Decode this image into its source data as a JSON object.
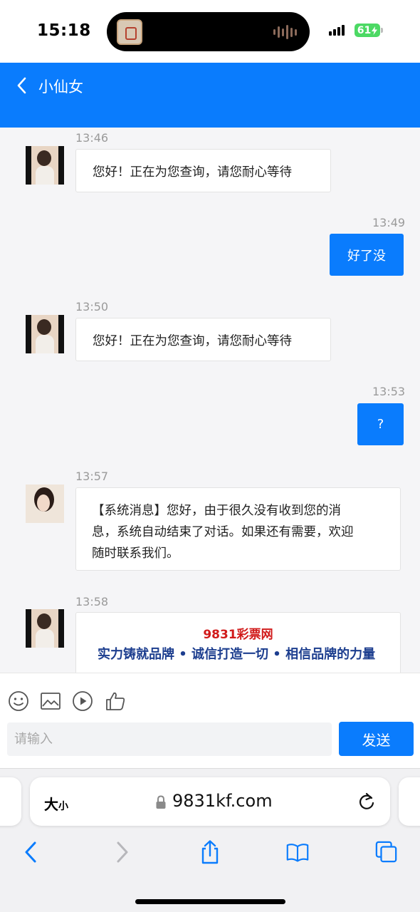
{
  "status_bar": {
    "time": "15:18",
    "battery": "61",
    "icons": [
      "app-thumbnail-icon",
      "audio-wave-icon",
      "cellular-signal-icon",
      "charging-bolt-icon"
    ]
  },
  "header": {
    "title": "小仙女",
    "back_icon": "chevron-left-icon",
    "background": "#0a7cfd"
  },
  "messages": [
    {
      "time": "13:46",
      "from": "agent",
      "text": "您好！正在为您查询，请您耐心等待"
    },
    {
      "time": "13:49",
      "from": "user",
      "text": "好了没"
    },
    {
      "time": "13:50",
      "from": "agent",
      "text": "您好！正在为您查询，请您耐心等待"
    },
    {
      "time": "13:53",
      "from": "user",
      "text": "?"
    },
    {
      "time": "13:57",
      "from": "system",
      "lines": [
        "【系统消息】您好，由于很久没有收到您的消",
        "息，系统自动结束了对话。如果还有需要，欢迎",
        "随时联系我们。"
      ]
    },
    {
      "time": "13:58",
      "from": "agent",
      "card_title": "9831彩票网",
      "card_slogan": "实力铸就品牌 • 诚信打造一切 • 相信品牌的力量"
    }
  ],
  "toolbar": {
    "icons": [
      "emoji-icon",
      "image-icon",
      "play-icon",
      "thumbs-up-icon"
    ]
  },
  "composer": {
    "placeholder": "请输入",
    "send_label": "发送"
  },
  "browser": {
    "text_size_big": "大",
    "text_size_small": "小",
    "url": "9831kf.com",
    "icons": [
      "lock-icon",
      "reload-icon",
      "back-arrow-icon",
      "forward-arrow-icon",
      "share-icon",
      "bookmarks-icon",
      "tabs-icon"
    ]
  },
  "colors": {
    "accent": "#0a7cfd",
    "promo_red": "#d11a1a",
    "promo_blue": "#1d3e8f"
  }
}
